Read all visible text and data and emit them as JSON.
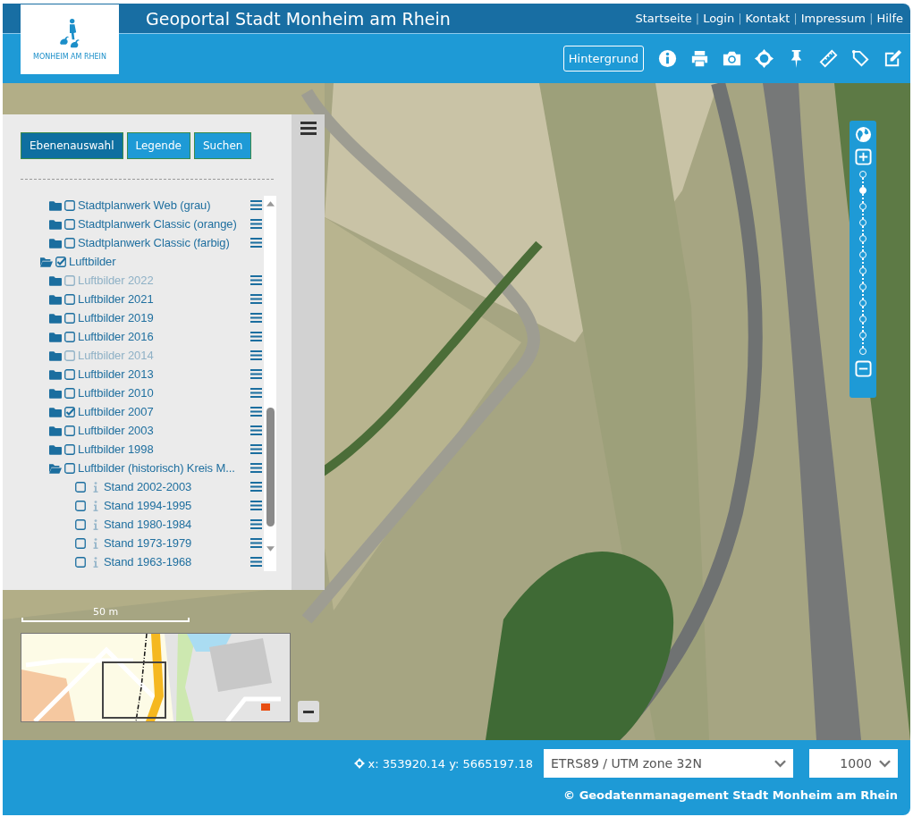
{
  "header": {
    "logo_text": "MONHEIM AM RHEIN",
    "title": "Geoportal Stadt Monheim am Rhein",
    "nav": [
      {
        "kind": "link",
        "label": "Startseite"
      },
      {
        "kind": "separator",
        "label": "|"
      },
      {
        "kind": "link",
        "label": "Login"
      },
      {
        "kind": "separator",
        "label": "|"
      },
      {
        "kind": "link",
        "label": "Kontakt"
      },
      {
        "kind": "separator",
        "label": "|"
      },
      {
        "kind": "link",
        "label": "Impressum"
      },
      {
        "kind": "separator",
        "label": "|"
      },
      {
        "kind": "link",
        "label": "Hilfe"
      }
    ],
    "background_button": "Hintergrund",
    "tools": [
      {
        "kind": "info"
      },
      {
        "kind": "print"
      },
      {
        "kind": "camera"
      },
      {
        "kind": "crosshair"
      },
      {
        "kind": "pin"
      },
      {
        "kind": "measure-line"
      },
      {
        "kind": "measure-area"
      },
      {
        "kind": "edit"
      }
    ]
  },
  "layer_panel": {
    "tabs": [
      {
        "label": "Ebenenauswahl",
        "selected": true
      },
      {
        "label": "Legende",
        "selected": false
      },
      {
        "label": "Suchen",
        "selected": false
      }
    ],
    "layer_tree": [
      {
        "children": [
          {
            "kind": "folder",
            "label": "Stadtplanwerk Web (grau)",
            "checked": false,
            "expanded": false,
            "disabled": false
          },
          {
            "kind": "folder",
            "label": "Stadtplanwerk Classic (orange)",
            "checked": false,
            "expanded": false,
            "disabled": false
          },
          {
            "kind": "folder",
            "label": "Stadtplanwerk Classic (farbig)",
            "checked": false,
            "expanded": false,
            "disabled": false
          }
        ]
      },
      {
        "kind": "category",
        "label": "Luftbilder",
        "checked": true,
        "expanded": true,
        "disabled": false,
        "children": [
          {
            "kind": "folder",
            "label": "Luftbilder 2022",
            "checked": false,
            "expanded": false,
            "disabled": true
          },
          {
            "kind": "folder",
            "label": "Luftbilder 2021",
            "checked": false,
            "expanded": false,
            "disabled": false
          },
          {
            "kind": "folder",
            "label": "Luftbilder 2019",
            "checked": false,
            "expanded": false,
            "disabled": false
          },
          {
            "kind": "folder",
            "label": "Luftbilder 2016",
            "checked": false,
            "expanded": false,
            "disabled": false
          },
          {
            "kind": "folder",
            "label": "Luftbilder 2014",
            "checked": false,
            "expanded": false,
            "disabled": true
          },
          {
            "kind": "folder",
            "label": "Luftbilder 2013",
            "checked": false,
            "expanded": false,
            "disabled": false
          },
          {
            "kind": "folder",
            "label": "Luftbilder 2010",
            "checked": false,
            "expanded": false,
            "disabled": false
          },
          {
            "kind": "folder",
            "label": "Luftbilder 2007",
            "checked": true,
            "expanded": false,
            "disabled": false
          },
          {
            "kind": "folder",
            "label": "Luftbilder 2003",
            "checked": false,
            "expanded": false,
            "disabled": false
          },
          {
            "kind": "folder",
            "label": "Luftbilder 1998",
            "checked": false,
            "expanded": false,
            "disabled": false
          },
          {
            "kind": "folder",
            "label": "Luftbilder (historisch) Kreis M...",
            "checked": false,
            "expanded": true,
            "disabled": false,
            "children": [
              {
                "kind": "layer",
                "label": "Stand 2002-2003",
                "checked": false,
                "disabled": false
              },
              {
                "kind": "layer",
                "label": "Stand 1994-1995",
                "checked": false,
                "disabled": false
              },
              {
                "kind": "layer",
                "label": "Stand 1980-1984",
                "checked": false,
                "disabled": false
              },
              {
                "kind": "layer",
                "label": "Stand 1973-1979",
                "checked": false,
                "disabled": false
              },
              {
                "kind": "layer",
                "label": "Stand 1963-1968",
                "checked": false,
                "disabled": false
              }
            ]
          }
        ]
      }
    ]
  },
  "zoom_bar": {
    "steps": [
      {
        "selected": false
      },
      {
        "selected": true
      },
      {
        "selected": false
      },
      {
        "selected": false
      },
      {
        "selected": false
      },
      {
        "selected": false
      },
      {
        "selected": false
      },
      {
        "selected": false
      },
      {
        "selected": false
      },
      {
        "selected": false
      },
      {
        "selected": false
      },
      {
        "selected": false
      }
    ]
  },
  "scale_bar": {
    "label": "50 m"
  },
  "footer": {
    "coordinates": "x: 353920.14 y: 5665197.18",
    "projection": "ETRS89 / UTM zone 32N",
    "scale": "1000",
    "copyright": "© Geodatenmanagement Stadt Monheim am Rhein"
  }
}
